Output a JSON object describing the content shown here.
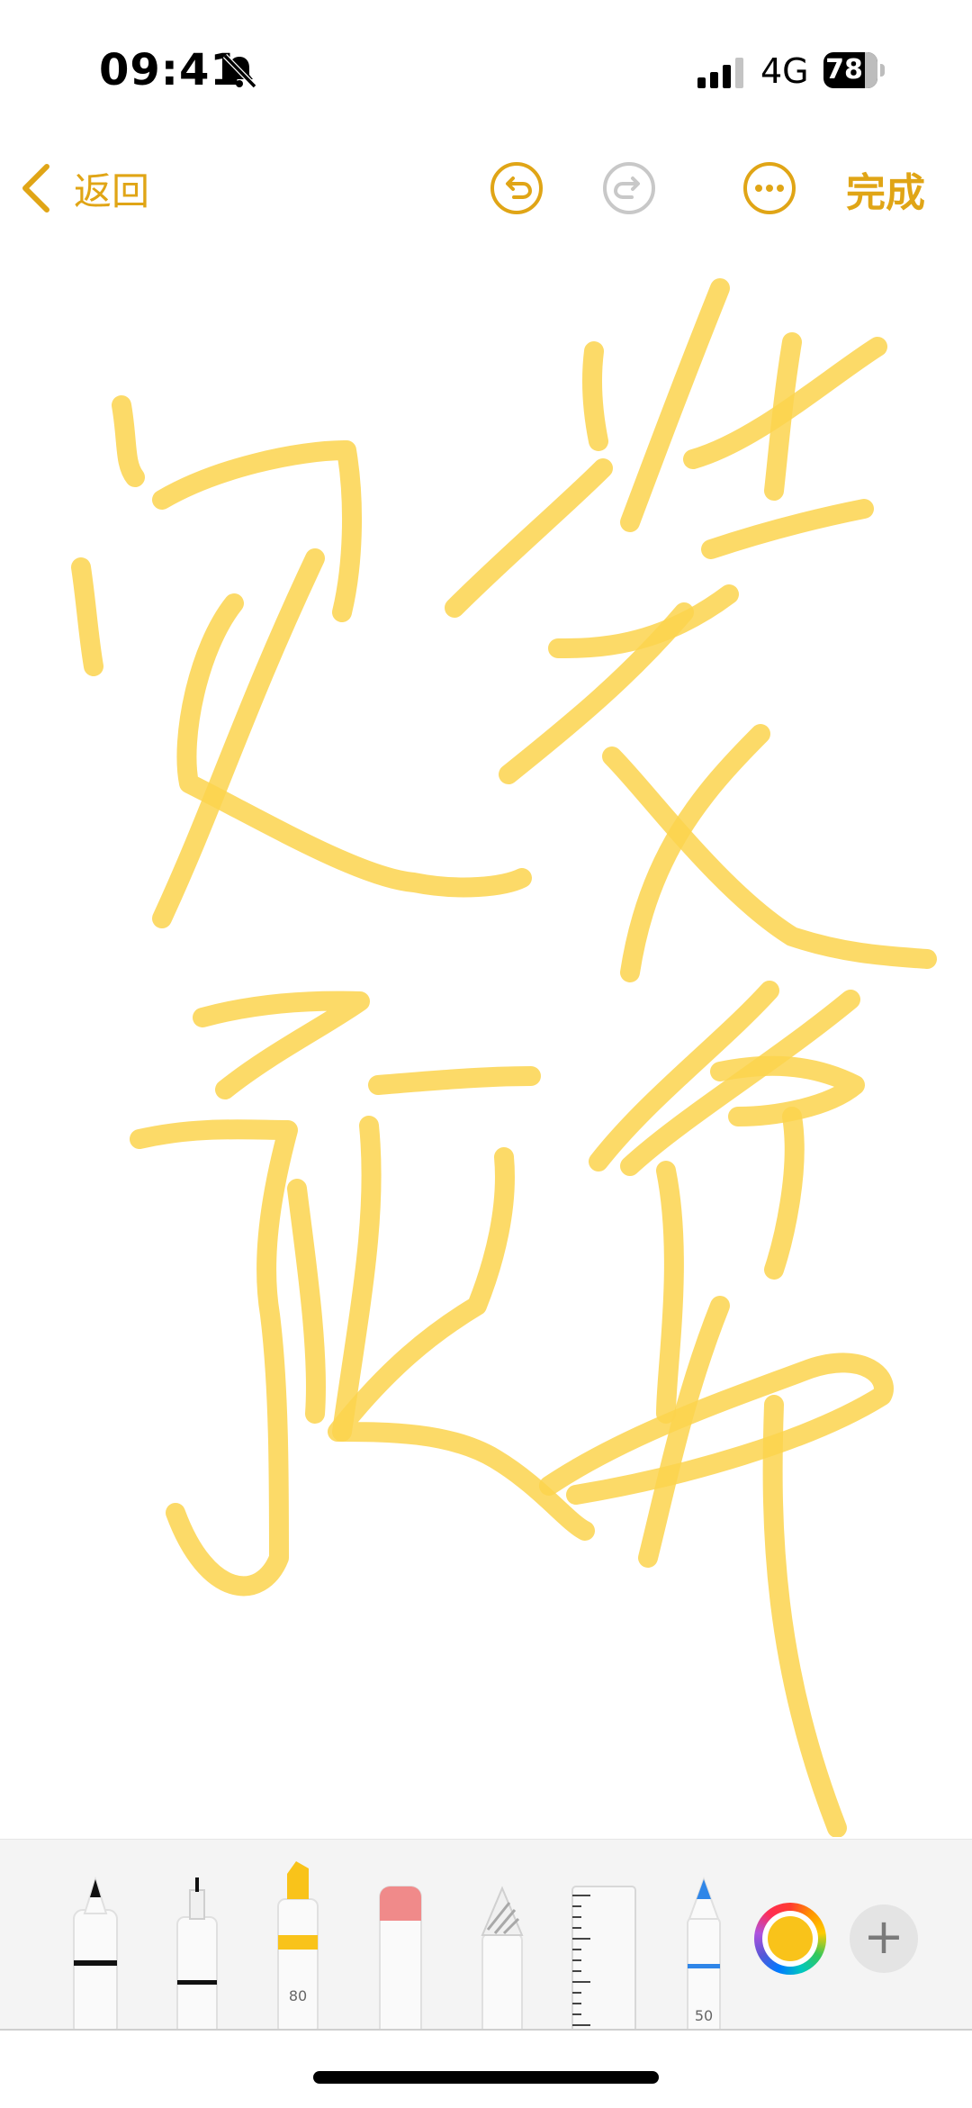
{
  "status_bar": {
    "time": "09:41",
    "network": "4G",
    "battery_level": "78",
    "icons": [
      "bell-slash-icon",
      "signal-icon",
      "battery-icon"
    ]
  },
  "nav": {
    "back_label": "返回",
    "done_label": "完成",
    "icons": [
      "chevron-left-icon",
      "undo-icon",
      "redo-icon",
      "more-icon"
    ]
  },
  "toolbar": {
    "tools": [
      "pen",
      "fineliner",
      "highlighter",
      "eraser",
      "lasso",
      "ruler",
      "pencil"
    ],
    "highlighter_width": "80",
    "pencil_width": "50",
    "selected_color": "#f9c31a"
  },
  "colors": {
    "accent": "#e0a516",
    "ink": "#fcd34d"
  }
}
